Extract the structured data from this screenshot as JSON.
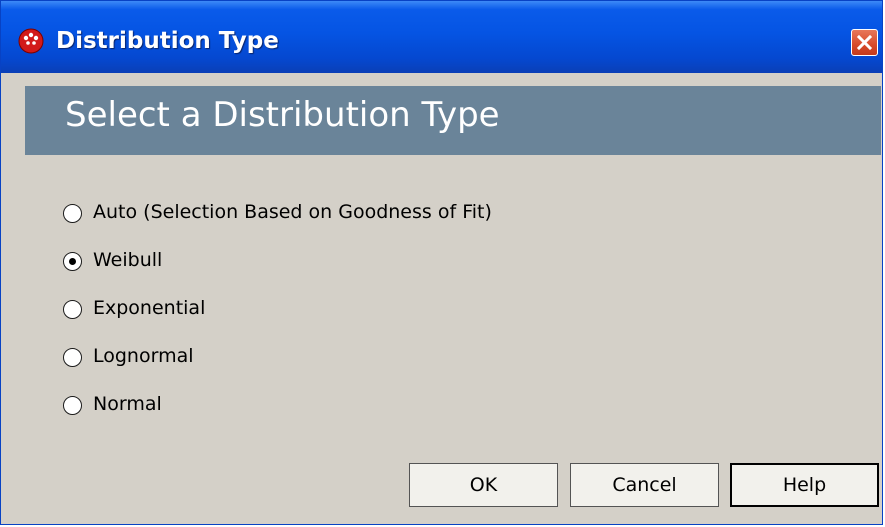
{
  "window": {
    "title": "Distribution Type",
    "app_icon": "red-dots-icon",
    "close_icon": "close-icon",
    "accent": "#0554e3"
  },
  "banner": {
    "title": "Select a Distribution Type",
    "color": "#6a8499"
  },
  "options": [
    {
      "label": "Auto (Selection Based on Goodness of Fit)",
      "selected": false
    },
    {
      "label": "Weibull",
      "selected": true
    },
    {
      "label": "Exponential",
      "selected": false
    },
    {
      "label": "Lognormal",
      "selected": false
    },
    {
      "label": "Normal",
      "selected": false
    }
  ],
  "buttons": {
    "ok": "OK",
    "cancel": "Cancel",
    "help": "Help"
  }
}
